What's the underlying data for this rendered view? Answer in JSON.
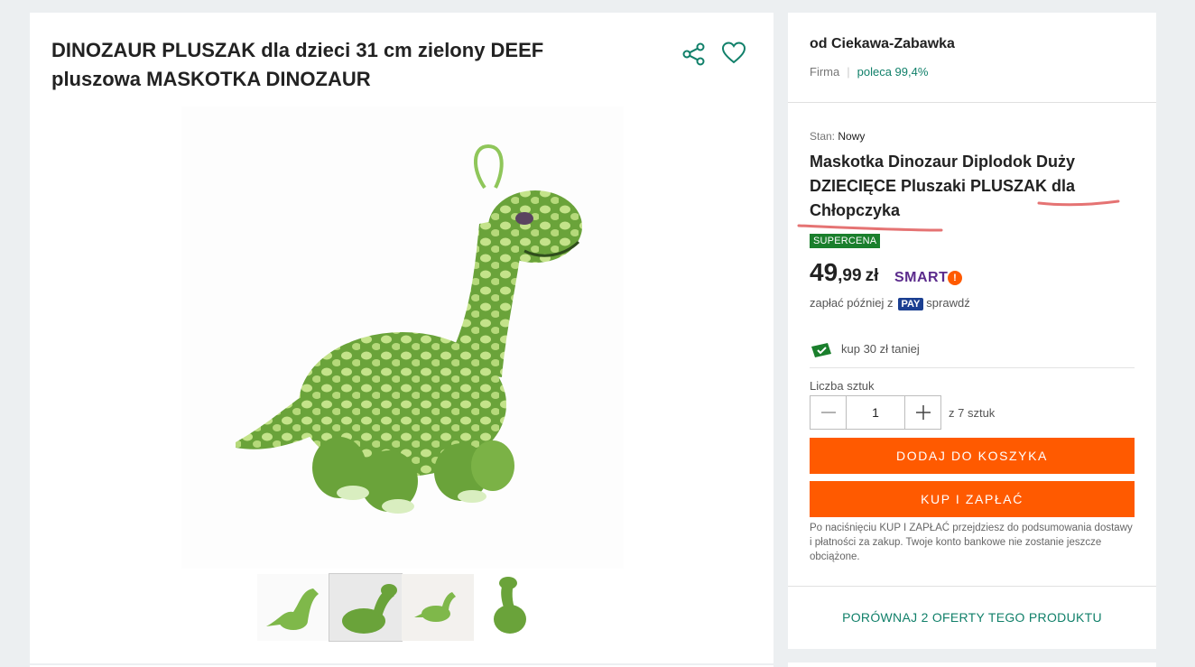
{
  "product": {
    "title": "DINOZAUR PLUSZAK dla dzieci 31 cm zielony DEEF pluszowa MASKOTKA DINOZAUR",
    "actions": {
      "share_icon": "share-icon",
      "favorite_icon": "heart-icon"
    },
    "thumbnails_count": 4
  },
  "seller": {
    "name": "od Ciekawa-Zabawka",
    "type": "Firma",
    "recommend": "poleca 99,4%"
  },
  "offer": {
    "condition_label": "Stan:",
    "condition_value": "Nowy",
    "title": "Maskotka Dinozaur Diplodok Duży DZIECIĘCE Pluszaki PLUSZAK dla Chłopczyka",
    "badge": "SUPERCENA",
    "price_int": "49",
    "price_dec": ",99",
    "currency": "zł",
    "smart_label": "SMART",
    "smart_mark": "!",
    "paylater_prefix": "zapłać później z",
    "pay_badge": "PAY",
    "paylater_suffix": "sprawdź",
    "coupon_text": "kup 30 zł taniej",
    "quantity_label": "Liczba sztuk",
    "quantity_value": "1",
    "quantity_of": "z 7 sztuk",
    "add_to_cart": "DODAJ DO KOSZYKA",
    "buy_now": "KUP I ZAPŁAĆ",
    "note": "Po naciśnięciu KUP I ZAPŁAĆ przejdziesz do podsumowania dostawy i płatności za zakup. Twoje konto bankowe nie zostanie jeszcze obciążone.",
    "compare": "PORÓWNAJ 2 OFERTY TEGO PRODUKTU"
  },
  "colors": {
    "accent_teal": "#11806a",
    "button_orange": "#ff5a00",
    "badge_green": "#1a7f2c",
    "smart_purple": "#5b2b8c",
    "annotation_red": "#e57373"
  }
}
